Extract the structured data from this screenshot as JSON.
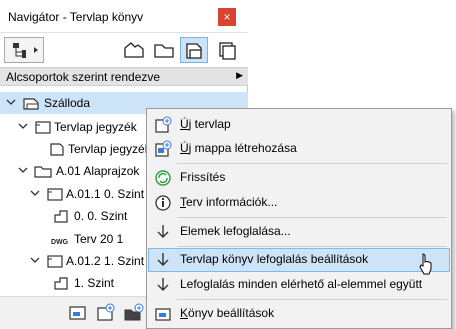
{
  "window": {
    "title": "Navigátor - Tervlap könyv",
    "close_glyph": "×"
  },
  "toolbar": {
    "buttons": [
      {
        "icon": "project-map-icon",
        "selected": false
      },
      {
        "icon": "view-map-icon",
        "selected": false
      },
      {
        "icon": "layout-book-icon",
        "selected": true
      },
      {
        "icon": "publisher-sets-icon",
        "selected": false
      }
    ]
  },
  "sortbar": {
    "label": "Alcsoportok szerint rendezve",
    "arrow": "▶"
  },
  "tree": {
    "items": [
      {
        "label": "Szálloda",
        "level": 0,
        "expanded": true,
        "icon": "book-icon",
        "selected": true
      },
      {
        "label": "Tervlap jegyzék",
        "level": 1,
        "expanded": true,
        "icon": "layout-icon"
      },
      {
        "label": "Tervlap jegyzék (",
        "level": 2,
        "icon": "sheet-icon"
      },
      {
        "label": "A.01 Alaprajzok",
        "level": 1,
        "expanded": true,
        "icon": "folder-icon"
      },
      {
        "label": "A.01.1 0. Szint",
        "level": 2,
        "expanded": true,
        "icon": "layout-icon"
      },
      {
        "label": "0. 0. Szint",
        "level": 3,
        "icon": "drawing-icon"
      },
      {
        "label": "Terv 20 1",
        "level": 3,
        "icon": "dwg-icon"
      },
      {
        "label": "A.01.2 1. Szint",
        "level": 2,
        "expanded": true,
        "icon": "layout-icon"
      },
      {
        "label": "1. Szint",
        "level": 3,
        "icon": "drawing-icon"
      }
    ],
    "dwg_text": "DWG"
  },
  "context_menu": {
    "items": [
      {
        "label": "Új tervlap",
        "underline_char": "Ú",
        "rest": "j tervlap",
        "icon": "new-layout-icon"
      },
      {
        "label": "Új mappa létrehozása",
        "underline_char": "Ú",
        "rest": "j mappa létrehozása",
        "icon": "new-folder-icon"
      },
      {
        "label": "Frissítés",
        "icon": "refresh-icon"
      },
      {
        "label": "Terv információk...",
        "underline_char": "T",
        "rest": "erv információk...",
        "icon": "info-icon"
      },
      {
        "label": "Elemek lefoglalása...",
        "icon": "reserve-icon"
      },
      {
        "label": "Tervlap könyv lefoglalás beállítások",
        "icon": "reserve-settings-icon",
        "hover": true
      },
      {
        "label": "Lefoglalás minden elérhető al-elemmel együtt",
        "icon": "reserve-all-icon"
      },
      {
        "label": "Könyv beállítások",
        "underline_char": "K",
        "rest": "önyv beállítások",
        "icon": "book-settings-icon"
      }
    ]
  },
  "colors": {
    "accent": "#cde3f7",
    "accent_border": "#80b9ee",
    "close": "#d9432f",
    "refresh": "#2e9a3e"
  }
}
